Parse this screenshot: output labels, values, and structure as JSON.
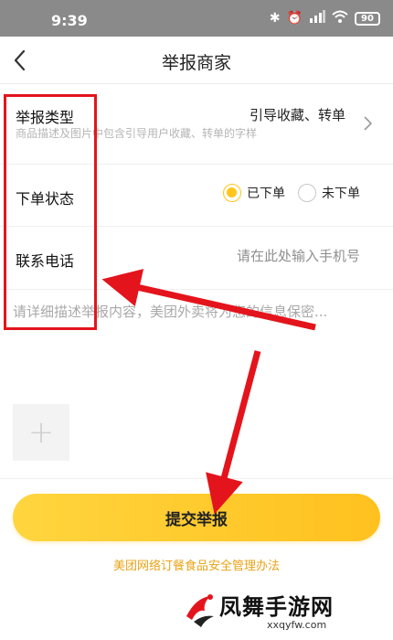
{
  "status_bar": {
    "time": "9:39",
    "battery": "90"
  },
  "nav": {
    "title": "举报商家",
    "back_icon": "chevron-left-icon"
  },
  "report_type": {
    "label": "举报类型",
    "value": "引导收藏、转单",
    "hint": "商品描述及图片中包含引导用户收藏、转单的字样",
    "icon": "chevron-right-icon"
  },
  "order_status": {
    "label": "下单状态",
    "options": [
      "已下单",
      "未下单"
    ],
    "selected": "已下单"
  },
  "contact": {
    "label": "联系电话",
    "placeholder": "请在此处输入手机号"
  },
  "description": {
    "placeholder": "请详细描述举报内容，美团外卖将为您的信息保密..."
  },
  "photo": {
    "icon": "plus-icon"
  },
  "submit": {
    "label": "提交举报"
  },
  "policy": {
    "label": "美团网络订餐食品安全管理办法"
  },
  "watermark": {
    "text": "凤舞手游网",
    "url": "xxqyfw.com"
  },
  "colors": {
    "accent": "#ffc51a",
    "link": "#e8a317",
    "annotation": "#e4141c",
    "status_bar": "#8a8a8a"
  }
}
